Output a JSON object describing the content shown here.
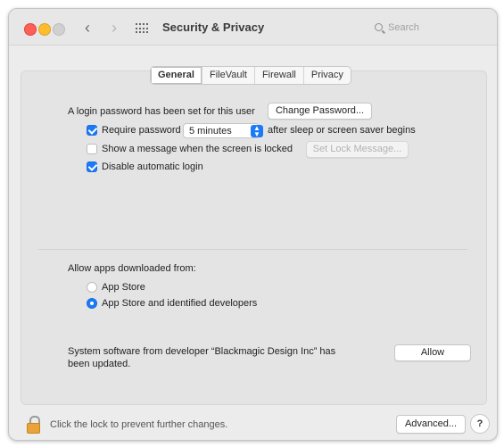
{
  "window": {
    "title": "Security & Privacy",
    "search_placeholder": "Search"
  },
  "tabs": [
    {
      "label": "General",
      "active": true
    },
    {
      "label": "FileVault",
      "active": false
    },
    {
      "label": "Firewall",
      "active": false
    },
    {
      "label": "Privacy",
      "active": false
    }
  ],
  "general": {
    "login_password_text": "A login password has been set for this user",
    "change_password_label": "Change Password...",
    "require_password_label": "Require password",
    "require_password_checked": true,
    "require_password_delay": "5 minutes",
    "after_sleep_text": "after sleep or screen saver begins",
    "show_message_label": "Show a message when the screen is locked",
    "show_message_checked": false,
    "set_lock_message_label": "Set Lock Message...",
    "disable_auto_login_label": "Disable automatic login",
    "disable_auto_login_checked": true
  },
  "apps": {
    "heading": "Allow apps downloaded from:",
    "option_app_store": "App Store",
    "option_identified": "App Store and identified developers",
    "selected": "App Store and identified developers"
  },
  "system_software": {
    "message_line1": "System software from developer “Blackmagic Design Inc” has",
    "message_line2": "been updated.",
    "allow_label": "Allow"
  },
  "footer": {
    "lock_text": "Click the lock to prevent further changes.",
    "advanced_label": "Advanced...",
    "help_label": "?"
  },
  "colors": {
    "accent": "#1a7af7",
    "lock": "#e8a43a"
  }
}
